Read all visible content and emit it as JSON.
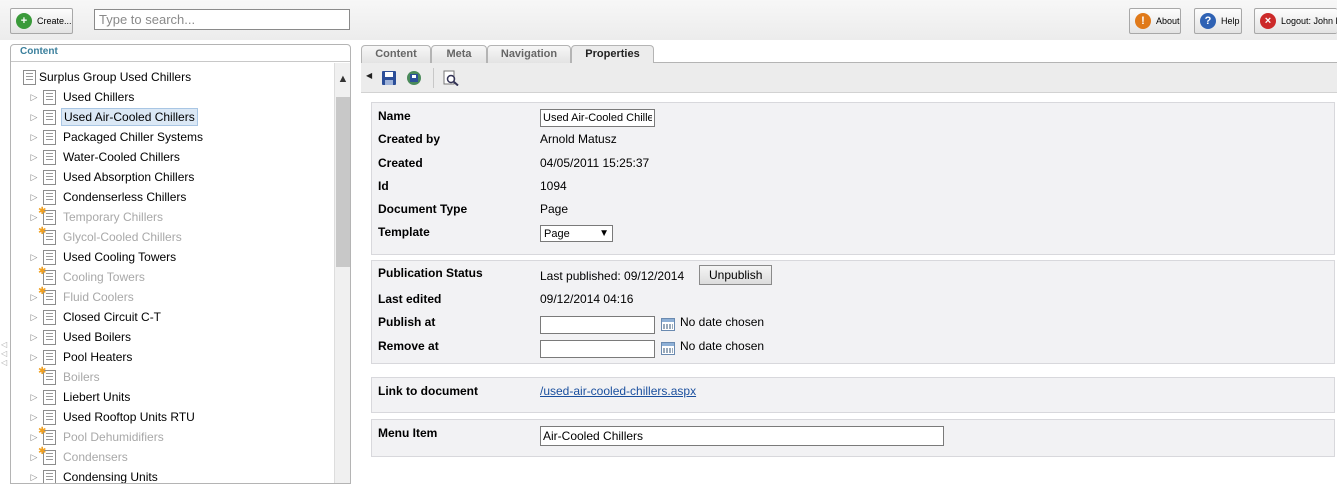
{
  "topbar": {
    "create_label": "Create...",
    "search_placeholder": "Type to search...",
    "about_label": "About",
    "help_label": "Help",
    "logout_label": "Logout: John B"
  },
  "left_panel": {
    "header": "Content",
    "root": "Surplus Group Used Chillers",
    "items": [
      {
        "label": "Used Chillers",
        "muted": false,
        "new": false,
        "expandable": true
      },
      {
        "label": "Used Air-Cooled Chillers",
        "muted": false,
        "new": false,
        "expandable": true,
        "selected": true
      },
      {
        "label": "Packaged Chiller Systems",
        "muted": false,
        "new": false,
        "expandable": true
      },
      {
        "label": "Water-Cooled Chillers",
        "muted": false,
        "new": false,
        "expandable": true
      },
      {
        "label": "Used Absorption Chillers",
        "muted": false,
        "new": false,
        "expandable": true
      },
      {
        "label": "Condenserless Chillers",
        "muted": false,
        "new": false,
        "expandable": true
      },
      {
        "label": "Temporary Chillers",
        "muted": true,
        "new": true,
        "expandable": true
      },
      {
        "label": "Glycol-Cooled Chillers",
        "muted": true,
        "new": true,
        "expandable": false
      },
      {
        "label": "Used Cooling Towers",
        "muted": false,
        "new": false,
        "expandable": true
      },
      {
        "label": "Cooling Towers",
        "muted": true,
        "new": true,
        "expandable": false
      },
      {
        "label": "Fluid Coolers",
        "muted": true,
        "new": true,
        "expandable": true
      },
      {
        "label": "Closed Circuit C-T",
        "muted": false,
        "new": false,
        "expandable": true
      },
      {
        "label": "Used Boilers",
        "muted": false,
        "new": false,
        "expandable": true
      },
      {
        "label": "Pool Heaters",
        "muted": false,
        "new": false,
        "expandable": true
      },
      {
        "label": "Boilers",
        "muted": true,
        "new": true,
        "expandable": false
      },
      {
        "label": "Liebert Units",
        "muted": false,
        "new": false,
        "expandable": true
      },
      {
        "label": "Used Rooftop Units RTU",
        "muted": false,
        "new": false,
        "expandable": true
      },
      {
        "label": "Pool Dehumidifiers",
        "muted": true,
        "new": true,
        "expandable": true
      },
      {
        "label": "Condensers",
        "muted": true,
        "new": true,
        "expandable": true
      },
      {
        "label": "Condensing Units",
        "muted": false,
        "new": false,
        "expandable": true
      }
    ]
  },
  "tabs": [
    "Content",
    "Meta",
    "Navigation",
    "Properties"
  ],
  "active_tab": "Properties",
  "properties": {
    "name_label": "Name",
    "name_value": "Used Air-Cooled Chillers",
    "created_by_label": "Created by",
    "created_by_value": "Arnold Matusz",
    "created_label": "Created",
    "created_value": "04/05/2011 15:25:37",
    "id_label": "Id",
    "id_value": "1094",
    "doctype_label": "Document Type",
    "doctype_value": "Page",
    "template_label": "Template",
    "template_value": "Page"
  },
  "publication": {
    "status_label": "Publication Status",
    "status_value": "Last published: 09/12/2014",
    "unpublish_label": "Unpublish",
    "last_edited_label": "Last edited",
    "last_edited_value": "09/12/2014 04:16",
    "publish_at_label": "Publish at",
    "publish_at_note": "No date chosen",
    "remove_at_label": "Remove at",
    "remove_at_note": "No date chosen"
  },
  "link": {
    "label": "Link to document",
    "url": "/used-air-cooled-chillers.aspx"
  },
  "menu": {
    "label": "Menu Item",
    "value": "Air-Cooled Chillers"
  }
}
